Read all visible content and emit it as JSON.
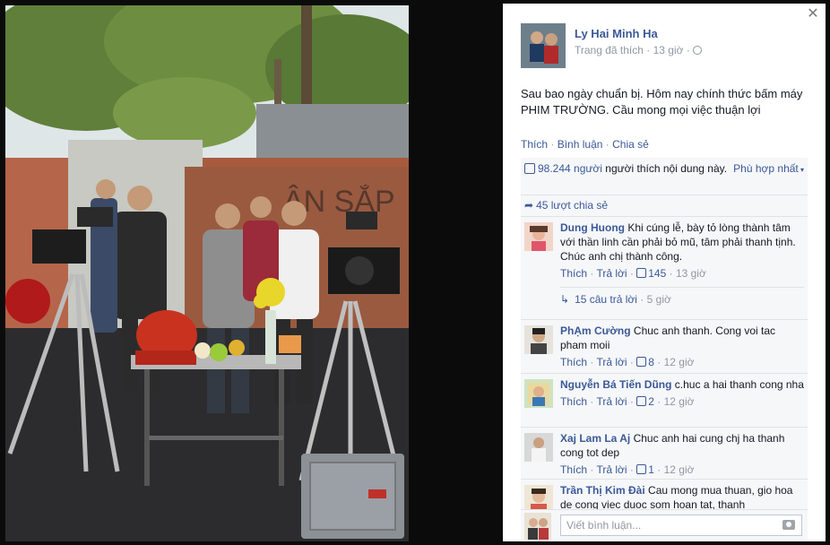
{
  "photo": {
    "alt_icon": "photo-filming-ceremony"
  },
  "panel": {
    "close_icon": "close-icon",
    "author": {
      "name": "Ly Hai Minh Ha",
      "meta": "Trang đã thích · 13 giờ ·",
      "privacy_icon": "globe-icon"
    },
    "post_text": "Sau bao ngày chuẩn bị. Hôm nay chính thức bấm máy PHIM TRƯỜNG. Cầu mong mọi việc thuận lợi",
    "actions": {
      "like": "Thích",
      "comment": "Bình luận",
      "share": "Chia sẻ"
    },
    "likes": {
      "count": "98.244 người",
      "text": " người thích nội dung này.",
      "sort": "Phù hợp nhất"
    },
    "shares": {
      "text": "45 lượt chia sẻ"
    },
    "comments": [
      {
        "name": "Dung Huong",
        "text": "Khi cúng lễ, bày tỏ lòng thành tâm với thần linh cần phải bỏ mũ, tâm phải thanh tịnh. Chúc anh chị thành công.",
        "like": "Thích",
        "reply": "Trả lời",
        "likes": "145",
        "time": "13 giờ"
      },
      {
        "name": "PhẠm Cường",
        "text": "Chuc anh thanh. Cong voi tac pham moii",
        "like": "Thích",
        "reply": "Trả lời",
        "likes": "8",
        "time": "12 giờ"
      },
      {
        "name": "Nguyễn Bá Tiến Dũng",
        "text": "c.huc a hai thanh cong nha",
        "like": "Thích",
        "reply": "Trả lời",
        "likes": "2",
        "time": "12 giờ"
      },
      {
        "name": "Xaj Lam La Aj",
        "text": "Chuc anh hai cung chj ha thanh cong tot dep",
        "like": "Thích",
        "reply": "Trả lời",
        "likes": "1",
        "time": "12 giờ"
      },
      {
        "name": "Trần Thị Kim Đài",
        "text": "Cau mong mua thuan, gio hoa de cong viec duoc som hoan tat, thanh"
      }
    ],
    "replies": {
      "text": "15 câu trả lời",
      "time": "5 giờ"
    },
    "composer": {
      "placeholder": "Viết bình luận..."
    },
    "colors": {
      "link": "#3b5998",
      "muted": "#9197a3",
      "feedback_bg": "#f6f7f9"
    }
  }
}
